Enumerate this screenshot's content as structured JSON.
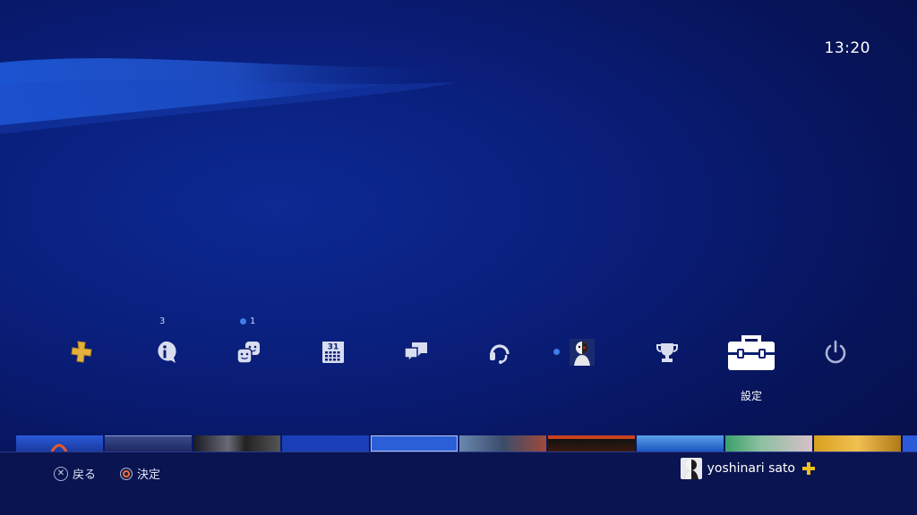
{
  "clock": {
    "time": "13:20"
  },
  "function_area": {
    "items": [
      {
        "name": "playstation-plus",
        "icon": "ps-plus-icon",
        "badge": ""
      },
      {
        "name": "notifications",
        "icon": "info-bubble-icon",
        "badge": "3"
      },
      {
        "name": "friends",
        "icon": "friends-icon",
        "badge": "1",
        "badge_dot": true
      },
      {
        "name": "events",
        "icon": "calendar-icon",
        "badge": "",
        "calendar_day": "31"
      },
      {
        "name": "messages",
        "icon": "messages-icon",
        "badge": ""
      },
      {
        "name": "party",
        "icon": "headset-icon",
        "badge": ""
      },
      {
        "name": "profile",
        "icon": "profile-avatar-icon",
        "badge": "",
        "status_dot": true
      },
      {
        "name": "trophies",
        "icon": "trophy-icon",
        "badge": ""
      },
      {
        "name": "settings",
        "icon": "toolbox-icon",
        "badge": "",
        "selected": true
      },
      {
        "name": "power",
        "icon": "power-icon",
        "badge": ""
      }
    ],
    "selected_label": "設定"
  },
  "bottom_bar": {
    "back_label": "戻る",
    "confirm_label": "決定",
    "username": "yoshinari sato",
    "plus_member": true
  },
  "colors": {
    "accent_blue": "#3f7fe8",
    "ps_plus_gold": "#e3b23c",
    "circle_orange": "#f26a3a"
  }
}
